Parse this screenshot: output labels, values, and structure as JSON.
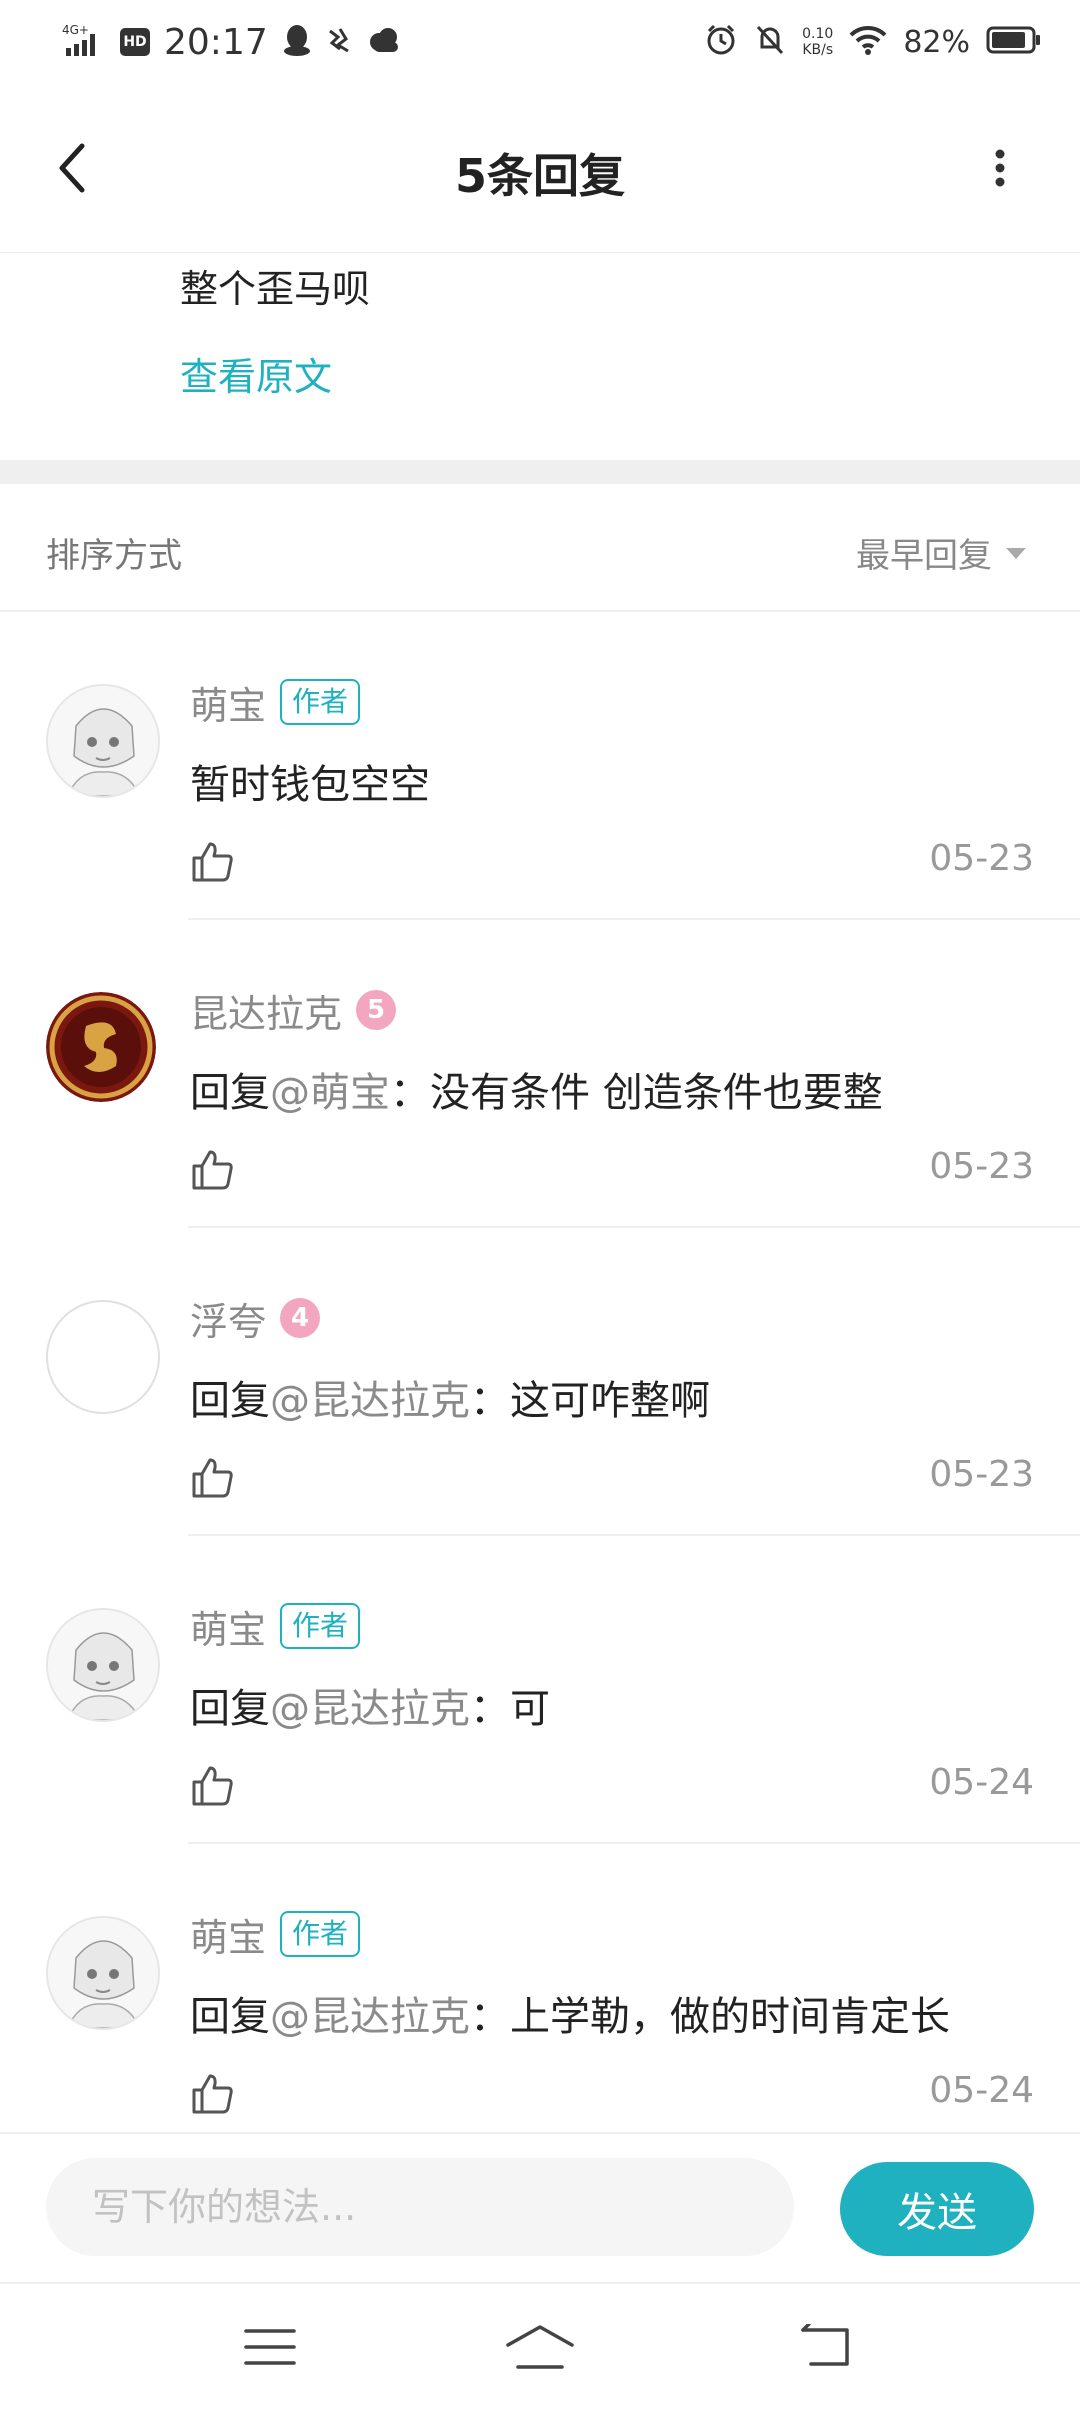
{
  "status_bar": {
    "time": "20:17",
    "network_type": "4G+",
    "hd_label": "HD",
    "net_speed_value": "0.10",
    "net_speed_unit": "KB/s",
    "battery_percent": "82%"
  },
  "header": {
    "title": "5条回复"
  },
  "original": {
    "text": "整个歪马呗",
    "view_link": "查看原文"
  },
  "sort": {
    "label": "排序方式",
    "value": "最早回复"
  },
  "comments": [
    {
      "name": "萌宝",
      "badge": "作者",
      "level": "",
      "prefix": "",
      "mention": "",
      "text": "暂时钱包空空",
      "date": "05-23"
    },
    {
      "name": "昆达拉克",
      "badge": "",
      "level": "5",
      "prefix": "回复",
      "mention": "@萌宝",
      "text": "：没有条件 创造条件也要整",
      "date": "05-23"
    },
    {
      "name": "浮夸",
      "badge": "",
      "level": "4",
      "prefix": "回复",
      "mention": "@昆达拉克",
      "text": "：这可咋整啊",
      "date": "05-23"
    },
    {
      "name": "萌宝",
      "badge": "作者",
      "level": "",
      "prefix": "回复",
      "mention": "@昆达拉克",
      "text": "：可",
      "date": "05-24"
    },
    {
      "name": "萌宝",
      "badge": "作者",
      "level": "",
      "prefix": "回复",
      "mention": "@昆达拉克",
      "text": "：上学勒，做的时间肯定长",
      "date": "05-24"
    }
  ],
  "input": {
    "placeholder": "写下你的想法...",
    "send_label": "发送"
  },
  "colors": {
    "accent": "#1fb1c0",
    "level_badge": "#f3a6c0"
  },
  "icons": {
    "back": "back-arrow-icon",
    "more": "more-vertical-icon",
    "sort": "caret-down-icon",
    "like": "thumbs-up-icon",
    "nav_menu": "menu-icon",
    "nav_home": "home-icon",
    "nav_back": "return-icon"
  }
}
